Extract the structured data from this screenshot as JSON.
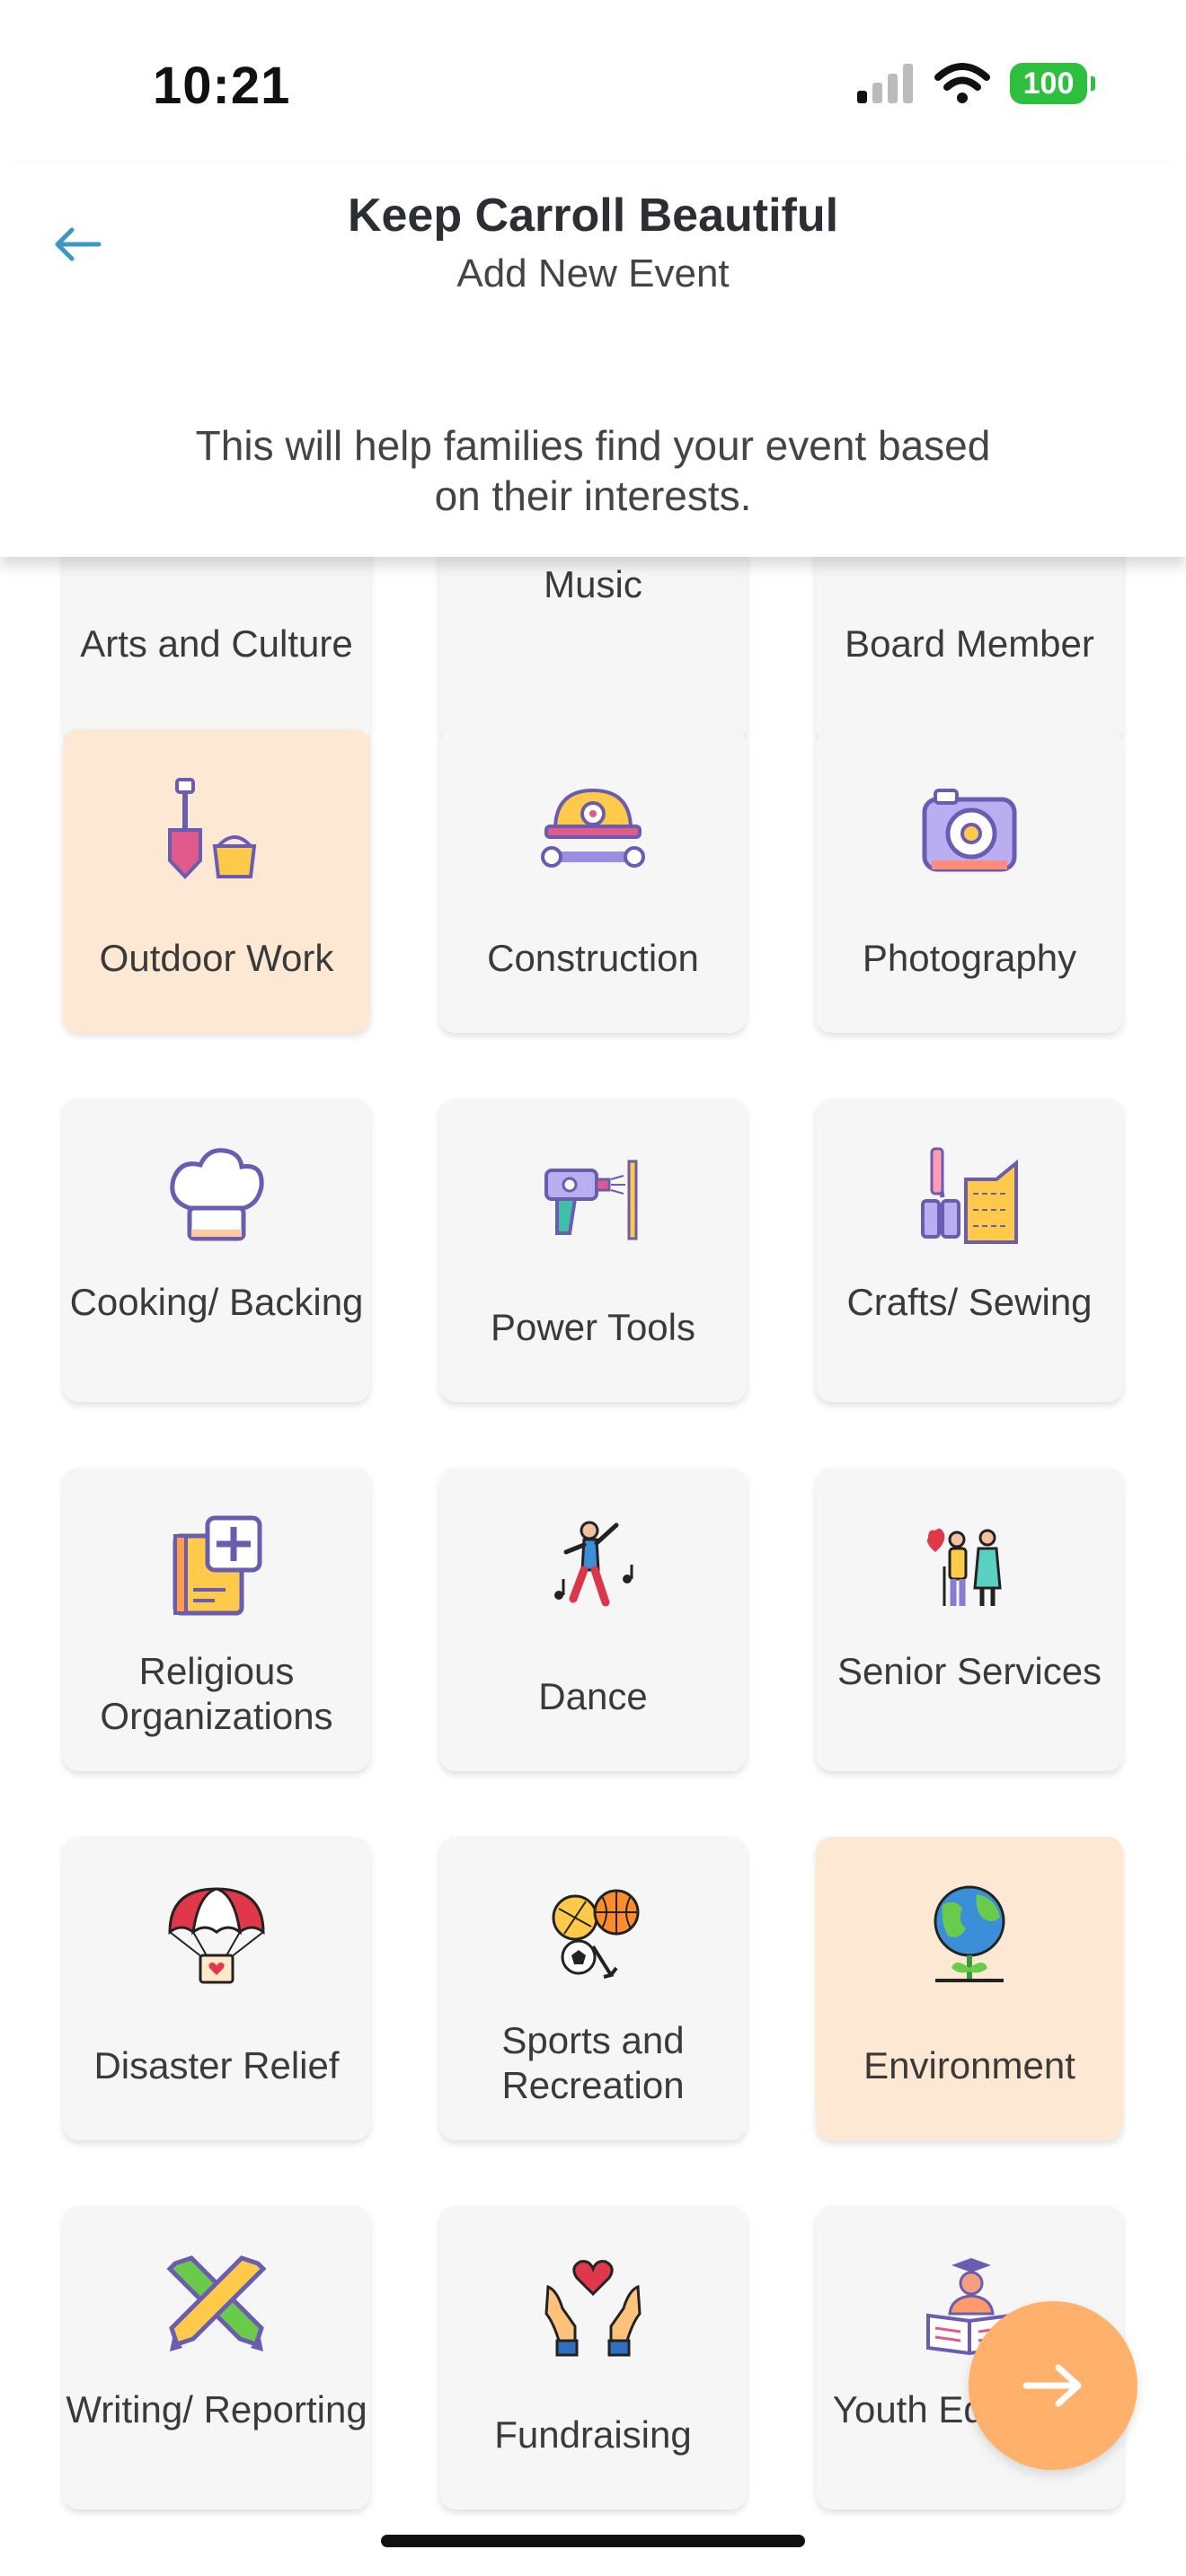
{
  "status": {
    "time": "10:21",
    "battery": "100"
  },
  "header": {
    "title": "Keep Carroll Beautiful",
    "subtitle": "Add New Event",
    "help_text": "This will help families find your event based on their interests."
  },
  "tiles": [
    {
      "label": "Arts and Culture",
      "icon": "arts-icon",
      "selected": false
    },
    {
      "label": "Music",
      "icon": "music-icon",
      "selected": false
    },
    {
      "label": "Board Member",
      "icon": "board-icon",
      "selected": false
    },
    {
      "label": "Outdoor Work",
      "icon": "shovel-bucket-icon",
      "selected": true
    },
    {
      "label": "Construction",
      "icon": "hard-hat-icon",
      "selected": false
    },
    {
      "label": "Photography",
      "icon": "camera-icon",
      "selected": false
    },
    {
      "label": "Cooking/ Backing",
      "icon": "chef-hat-icon",
      "selected": false
    },
    {
      "label": "Power Tools",
      "icon": "drill-icon",
      "selected": false
    },
    {
      "label": "Crafts/ Sewing",
      "icon": "scissors-fabric-icon",
      "selected": false
    },
    {
      "label": "Religious Organizations",
      "icon": "bible-icon",
      "selected": false
    },
    {
      "label": "Dance",
      "icon": "dancer-icon",
      "selected": false
    },
    {
      "label": "Senior Services",
      "icon": "seniors-icon",
      "selected": false
    },
    {
      "label": "Disaster Relief",
      "icon": "parachute-icon",
      "selected": false
    },
    {
      "label": "Sports and Recreation",
      "icon": "sports-balls-icon",
      "selected": false
    },
    {
      "label": "Environment",
      "icon": "globe-plant-icon",
      "selected": true
    },
    {
      "label": "Writing/ Reporting",
      "icon": "pencils-icon",
      "selected": false
    },
    {
      "label": "Fundraising",
      "icon": "hands-heart-icon",
      "selected": false
    },
    {
      "label": "Youth Education",
      "icon": "graduate-book-icon",
      "selected": false
    }
  ]
}
